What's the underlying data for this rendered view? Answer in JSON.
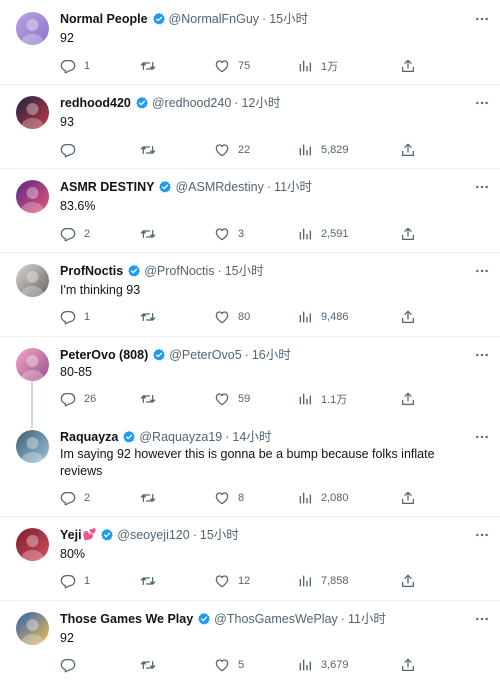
{
  "tweets": [
    {
      "name": "Normal People",
      "emoji": "",
      "handle": "@NormalFnGuy",
      "time": "15小时",
      "text": "92",
      "replies": "1",
      "retweets": "",
      "likes": "75",
      "views": "1万",
      "avatar_colors": [
        "#b9a3e3",
        "#8f74c9"
      ]
    },
    {
      "name": "redhood420",
      "emoji": "",
      "handle": "@redhood240",
      "time": "12小时",
      "text": "93",
      "replies": "",
      "retweets": "",
      "likes": "22",
      "views": "5,829",
      "avatar_colors": [
        "#1c2340",
        "#c7374a"
      ]
    },
    {
      "name": "ASMR DESTINY",
      "emoji": "",
      "handle": "@ASMRdestiny",
      "time": "11小时",
      "text": "83.6%",
      "replies": "2",
      "retweets": "",
      "likes": "3",
      "views": "2,591",
      "avatar_colors": [
        "#5b2a86",
        "#e8547a"
      ]
    },
    {
      "name": "ProfNoctis",
      "emoji": "",
      "handle": "@ProfNoctis",
      "time": "15小时",
      "text": "I'm thinking 93",
      "replies": "1",
      "retweets": "",
      "likes": "80",
      "views": "9,486",
      "avatar_colors": [
        "#d9d4cf",
        "#6b6560"
      ]
    },
    {
      "name": "PeterOvo (808)",
      "emoji": "",
      "handle": "@PeterOvo5",
      "time": "16小时",
      "text": "80-85",
      "replies": "26",
      "retweets": "",
      "likes": "59",
      "views": "1.1万",
      "avatar_colors": [
        "#f2a7c8",
        "#9b4d8c"
      ]
    },
    {
      "name": "Raquayza",
      "emoji": "",
      "handle": "@Raquayza19",
      "time": "14小时",
      "text": "Im saying 92 however this is gonna be a bump because folks inflate reviews",
      "replies": "2",
      "retweets": "",
      "likes": "8",
      "views": "2,080",
      "avatar_colors": [
        "#3e5f73",
        "#9cc3d6"
      ]
    },
    {
      "name": "Yeji",
      "emoji": "💕",
      "handle": "@seoyeji120",
      "time": "15小时",
      "text": "80%",
      "replies": "1",
      "retweets": "",
      "likes": "12",
      "views": "7,858",
      "avatar_colors": [
        "#7a1f2e",
        "#d44d5e"
      ]
    },
    {
      "name": "Those Games We Play",
      "emoji": "",
      "handle": "@ThosGamesWePlay",
      "time": "11小时",
      "text": "92",
      "replies": "",
      "retweets": "",
      "likes": "5",
      "views": "3,679",
      "avatar_colors": [
        "#2f5fb3",
        "#f2c14e"
      ]
    }
  ],
  "colors": {
    "text": "#0f1419",
    "muted": "#536471",
    "verified": "#1d9bf0",
    "divider": "#eff3f4",
    "thread_line": "#cfd9de"
  }
}
